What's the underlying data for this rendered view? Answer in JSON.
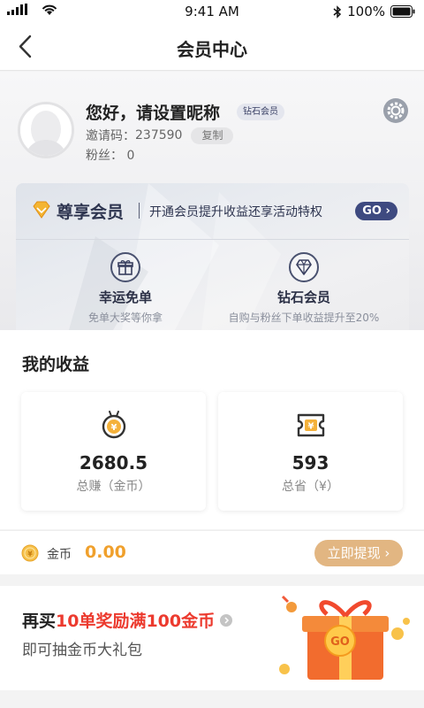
{
  "status_bar": {
    "time": "9:41 AM",
    "battery": "100%"
  },
  "nav": {
    "title": "会员中心"
  },
  "profile": {
    "greeting": "您好，请设置昵称",
    "level_badge": "钻石会员",
    "invite_label": "邀请码：",
    "invite_code": "237590",
    "copy_label": "复制",
    "fans_label": "粉丝：",
    "fans_count": "0"
  },
  "vip": {
    "title": "尊享会员",
    "description": "开通会员提升收益还享活动特权",
    "go_label": "GO",
    "perks": [
      {
        "title": "幸运免单",
        "subtitle": "免单大奖等你拿",
        "icon": "gift-icon"
      },
      {
        "title": "钻石会员",
        "subtitle": "自购与粉丝下单收益提升至20%",
        "icon": "diamond-icon"
      }
    ]
  },
  "earnings": {
    "title": "我的收益",
    "cards": [
      {
        "value": "2680.5",
        "label": "总赚（金币）",
        "icon": "coin-medal-icon"
      },
      {
        "value": "593",
        "label": "总省（¥）",
        "icon": "coupon-icon"
      }
    ]
  },
  "coins": {
    "label": "金币",
    "value": "0.00",
    "withdraw_label": "立即提现"
  },
  "promo": {
    "line1_prefix": "再买",
    "line1_highlight": "10单奖励满100金币",
    "line2": "即可抽金币大礼包",
    "gift_label": "GO"
  },
  "colors": {
    "accent": "#f0a02c",
    "highlight": "#ec3a2e",
    "vip_navy": "#3e4a80",
    "withdraw": "#e2b682"
  }
}
